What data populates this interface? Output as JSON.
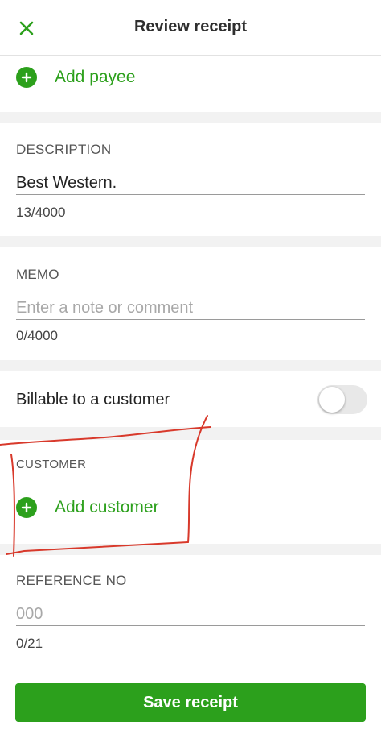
{
  "header": {
    "title": "Review receipt",
    "close_icon": "close-icon"
  },
  "payee": {
    "add_label": "Add payee",
    "icon": "plus-circle-icon"
  },
  "description": {
    "label": "DESCRIPTION",
    "value": "Best Western.",
    "counter": "13/4000"
  },
  "memo": {
    "label": "MEMO",
    "placeholder": "Enter a note or comment",
    "counter": "0/4000"
  },
  "billable": {
    "label": "Billable to a customer",
    "enabled": false
  },
  "customer": {
    "label": "CUSTOMER",
    "add_label": "Add customer",
    "icon": "plus-circle-icon"
  },
  "reference": {
    "label": "REFERENCE NO",
    "placeholder": "000",
    "counter": "0/21"
  },
  "footer": {
    "save_label": "Save receipt"
  },
  "colors": {
    "accent": "#2ca01c",
    "annotation": "#d8392b",
    "separator": "#f2f2f2"
  }
}
